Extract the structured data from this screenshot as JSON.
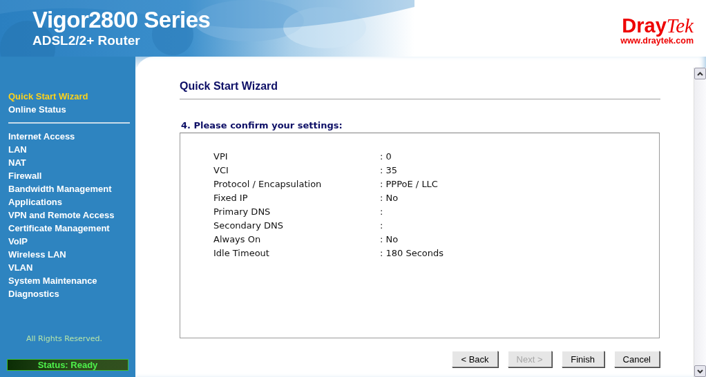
{
  "header": {
    "product": "Vigor2800 Series",
    "subtitle": "ADSL2/2+ Router",
    "brand_bold": "Dray",
    "brand_italic": "Tek",
    "brand_url": "www.draytek.com"
  },
  "sidebar": {
    "top_items": [
      {
        "label": "Quick Start Wizard",
        "selected": true
      },
      {
        "label": "Online Status",
        "selected": false
      }
    ],
    "items": [
      {
        "label": "Internet Access",
        "selected": false
      },
      {
        "label": "LAN",
        "selected": false
      },
      {
        "label": "NAT",
        "selected": false
      },
      {
        "label": "Firewall",
        "selected": false
      },
      {
        "label": "Bandwidth Management",
        "selected": false
      },
      {
        "label": "Applications",
        "selected": false
      },
      {
        "label": "VPN and Remote Access",
        "selected": false
      },
      {
        "label": "Certificate Management",
        "selected": false
      },
      {
        "label": "VoIP",
        "selected": false
      },
      {
        "label": "Wireless LAN",
        "selected": false
      },
      {
        "label": "VLAN",
        "selected": false
      },
      {
        "label": "System Maintenance",
        "selected": false
      },
      {
        "label": "Diagnostics",
        "selected": false
      }
    ],
    "copyright": "All Rights Reserved.",
    "status": "Status: Ready"
  },
  "main": {
    "title": "Quick Start Wizard",
    "step_heading": "4. Please confirm your settings:",
    "settings": [
      {
        "label": "VPI",
        "value": ": 0"
      },
      {
        "label": "VCI",
        "value": ": 35"
      },
      {
        "label": "Protocol / Encapsulation",
        "value": ": PPPoE / LLC"
      },
      {
        "label": "Fixed IP",
        "value": ": No"
      },
      {
        "label": "Primary DNS",
        "value": ":"
      },
      {
        "label": "Secondary DNS",
        "value": ":"
      },
      {
        "label": "Always On",
        "value": ": No"
      },
      {
        "label": "Idle Timeout",
        "value": ": 180 Seconds"
      }
    ],
    "buttons": [
      {
        "label": "< Back",
        "disabled": false
      },
      {
        "label": "Next >",
        "disabled": true
      },
      {
        "label": "Finish",
        "disabled": false
      },
      {
        "label": "Cancel",
        "disabled": false
      }
    ]
  }
}
